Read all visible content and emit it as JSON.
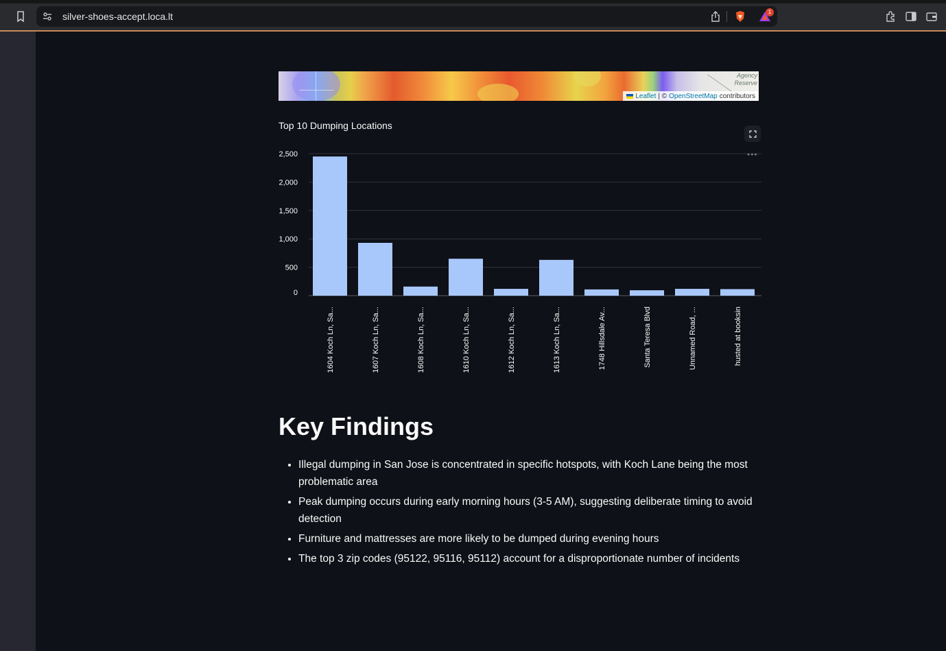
{
  "browser": {
    "url": "silver-shoes-accept.loca.lt",
    "notification_count": "1",
    "icons": [
      "bookmark-icon",
      "site-settings-icon",
      "share-icon",
      "brave-shield-icon",
      "brave-rewards-icon",
      "extensions-icon",
      "sidebar-icon",
      "wallet-icon"
    ]
  },
  "map": {
    "agency_label_line1": "Agency",
    "agency_label_line2": "Reserve",
    "attribution": {
      "leaflet": "Leaflet",
      "separator": "| ©",
      "osm": "OpenStreetMap",
      "suffix": "contributors"
    }
  },
  "chart": {
    "title": "Top 10 Dumping Locations",
    "fullscreen_icon": "expand-icon",
    "menu_icon": "more-icon"
  },
  "chart_data": {
    "type": "bar",
    "title": "Top 10 Dumping Locations",
    "categories": [
      "1604 Koch Ln, Sa...",
      "1607 Koch Ln, Sa...",
      "1608 Koch Ln, Sa...",
      "1610 Koch Ln, Sa...",
      "1612 Koch Ln, Sa...",
      "1613 Koch Ln, Sa...",
      "1748 Hillsdale Av...",
      "Santa Teresa Blvd",
      "Unnamed Road, ...",
      "husted at booksin"
    ],
    "values": [
      2450,
      930,
      160,
      650,
      120,
      630,
      110,
      95,
      120,
      115
    ],
    "yticks": [
      "0",
      "500",
      "1,000",
      "1,500",
      "2,000",
      "2,500"
    ],
    "ylim": [
      0,
      2500
    ],
    "grid": true,
    "bar_color": "#a8c8fb"
  },
  "findings": {
    "title": "Key Findings",
    "items": [
      "Illegal dumping in San Jose is concentrated in specific hotspots, with Koch Lane being the most problematic area",
      "Peak dumping occurs during early morning hours (3-5 AM), suggesting deliberate timing to avoid detection",
      "Furniture and mattresses are more likely to be dumped during evening hours",
      "The top 3 zip codes (95122, 95116, 95112) account for a disproportionate number of incidents"
    ]
  }
}
